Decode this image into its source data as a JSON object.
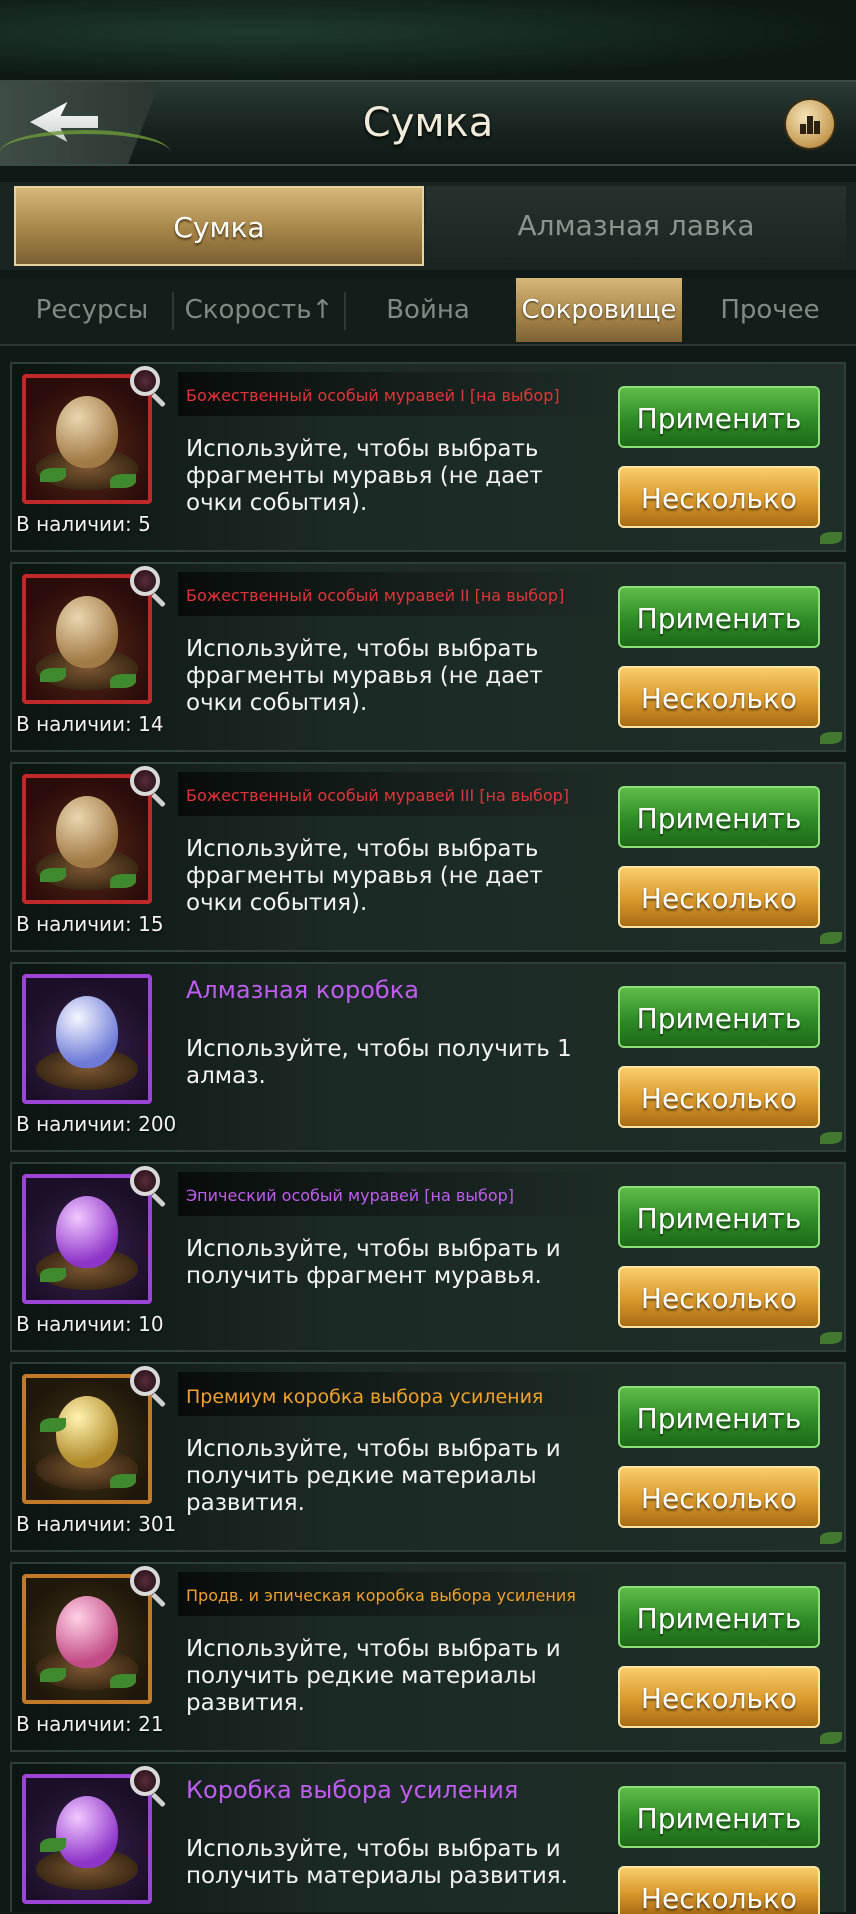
{
  "header": {
    "title": "Сумка"
  },
  "main_tabs": [
    {
      "label": "Сумка",
      "active": true
    },
    {
      "label": "Алмазная лавка",
      "active": false
    }
  ],
  "sub_tabs": [
    {
      "label": "Ресурсы"
    },
    {
      "label": "Скорость↑"
    },
    {
      "label": "Война"
    },
    {
      "label": "Сокровище",
      "active": true
    },
    {
      "label": "Прочее"
    }
  ],
  "buttons": {
    "apply": "Применить",
    "multiple": "Несколько"
  },
  "items": [
    {
      "name": "Божественный особый муравей I [на выбор]",
      "desc": "Используйте, чтобы выбрать фрагменты муравья (не дает очки события).",
      "stock": "В наличии: 5",
      "rarity": "red",
      "name_color": "#e3343a"
    },
    {
      "name": "Божественный особый муравей II [на выбор]",
      "desc": "Используйте, чтобы выбрать фрагменты муравья (не дает очки события).",
      "stock": "В наличии: 14",
      "rarity": "red",
      "name_color": "#e3343a"
    },
    {
      "name": "Божественный особый муравей III [на выбор]",
      "desc": "Используйте, чтобы выбрать фрагменты муравья (не дает очки события).",
      "stock": "В наличии: 15",
      "rarity": "red",
      "name_color": "#e3343a"
    },
    {
      "name": "Алмазная коробка",
      "desc": "Используйте, чтобы получить 1 алмаз.",
      "stock": "В наличии: 200",
      "rarity": "purple",
      "name_color": "#c15cf2"
    },
    {
      "name": "Эпический особый муравей [на выбор]",
      "desc": "Используйте, чтобы выбрать и получить фрагмент муравья.",
      "stock": "В наличии: 10",
      "rarity": "purple",
      "name_color": "#c15cf2"
    },
    {
      "name": "Премиум коробка выбора усиления",
      "desc": "Используйте, чтобы выбрать и получить редкие материалы развития.",
      "stock": "В наличии: 301",
      "rarity": "orange",
      "name_color": "#f2a12a"
    },
    {
      "name": "Продв. и эпическая коробка выбора усиления",
      "desc": "Используйте, чтобы выбрать и получить редкие материалы развития.",
      "stock": "В наличии: 21",
      "rarity": "orange",
      "name_color": "#f2a12a"
    },
    {
      "name": "Коробка выбора усиления",
      "desc": "Используйте, чтобы выбрать и получить материалы развития.",
      "stock": "",
      "rarity": "purple",
      "name_color": "#c15cf2"
    }
  ],
  "icons": {
    "back": "back-arrow-icon",
    "rank": "leaderboard-icon",
    "inspect": "magnifier-icon"
  }
}
